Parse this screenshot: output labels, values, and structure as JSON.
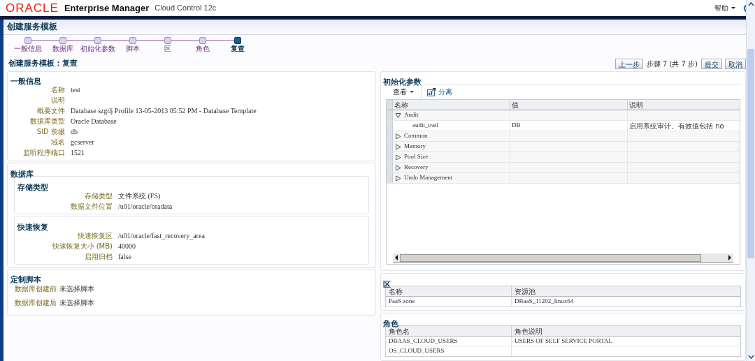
{
  "header": {
    "brand": "ORACLE",
    "product": "Enterprise Manager",
    "edition": "Cloud Control 12c",
    "help": "帮助"
  },
  "page_title": "创建服务模板",
  "steps": [
    {
      "label": "一般信息",
      "selected": false
    },
    {
      "label": "数据库",
      "selected": false
    },
    {
      "label": "初始化参数",
      "selected": false
    },
    {
      "label": "脚本",
      "selected": false
    },
    {
      "label": "区",
      "selected": false
    },
    {
      "label": "角色",
      "selected": false
    },
    {
      "label": "复查",
      "selected": true
    }
  ],
  "subtitle": "创建服务模板：复查",
  "nav": {
    "back": "上一步",
    "step_text": "步骤 7 (共 7 步)",
    "submit": "提交",
    "cancel": "取消"
  },
  "general": {
    "title": "一般信息",
    "fields": [
      {
        "label": "名称",
        "value": "test"
      },
      {
        "label": "说明"
      },
      {
        "label": "概要文件",
        "value": "Database szgdj Profile 13-05-2013 05:52 PM - Database Template"
      },
      {
        "label": "数据库类型",
        "value": "Oracle Database"
      },
      {
        "label": "SID 前缀",
        "value": "db"
      },
      {
        "label": "域名",
        "value": "gcserver"
      },
      {
        "label": "监听程序端口",
        "value": "1521"
      }
    ]
  },
  "database": {
    "title": "数据库",
    "sections": [
      {
        "title": "存储类型",
        "fields": [
          {
            "label": "存储类型",
            "value": "文件系统 (FS)"
          },
          {
            "label": "数据文件位置",
            "value": "/u01/oracle/oradata"
          }
        ]
      },
      {
        "title": "快速恢复",
        "fields": [
          {
            "label": "快速恢复区",
            "value": "/u01/oracle/fast_recovery_area"
          },
          {
            "label": "快速恢复大小 (MB)",
            "value": "40000"
          },
          {
            "label": "启用归档",
            "value": "false"
          }
        ]
      }
    ]
  },
  "scripts": {
    "title": "定制脚本",
    "fields": [
      {
        "label": "数据库创建前",
        "value": "未选择脚本"
      },
      {
        "label": "数据库创建后",
        "value": "未选择脚本"
      }
    ]
  },
  "init_params": {
    "title": "初始化参数",
    "view_menu": "查看",
    "detach": "分离",
    "columns": [
      "名称",
      "值",
      "说明"
    ],
    "rows": [
      {
        "name": "Audit",
        "expanded": true,
        "children": [
          {
            "name": "audit_trail",
            "value": "DB",
            "description": "启用系统审计。有效值包括 no"
          }
        ]
      },
      {
        "name": "Common",
        "expanded": false
      },
      {
        "name": "Memory",
        "expanded": false
      },
      {
        "name": "Pool Size",
        "expanded": false
      },
      {
        "name": "Recovery",
        "expanded": false
      },
      {
        "name": "Undo Management",
        "expanded": false
      }
    ]
  },
  "zone": {
    "title": "区",
    "columns": [
      "名称",
      "资源池"
    ],
    "rows": [
      [
        "PaaS zone",
        "DBaaS_11202_linux64"
      ]
    ]
  },
  "roles": {
    "title": "角色",
    "columns": [
      "角色名",
      "角色说明"
    ],
    "rows": [
      [
        "DBAAS_CLOUD_USERS",
        "USERS OF SELF SERVICE PORTAL"
      ],
      [
        "OS_CLOUD_USERS",
        ""
      ]
    ]
  }
}
